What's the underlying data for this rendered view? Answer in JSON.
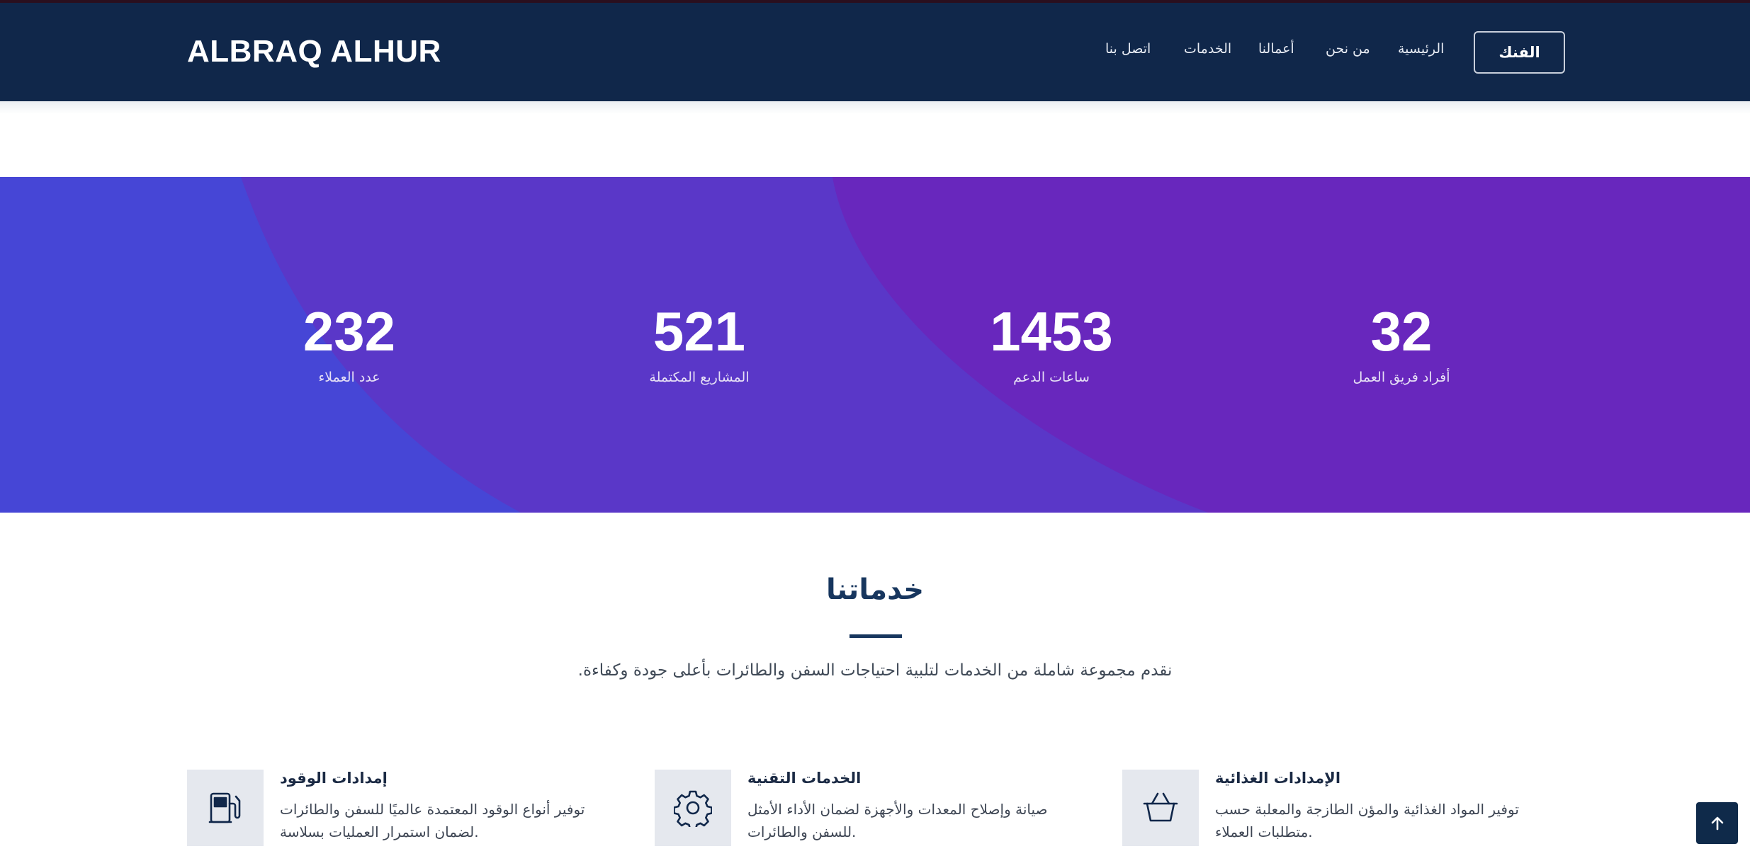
{
  "header": {
    "brand": "ALBRAQ ALHUR",
    "nav": [
      {
        "label": "الرئيسية"
      },
      {
        "label": "من نحن"
      },
      {
        "label": "أعمالنا"
      },
      {
        "label": "الخدمات"
      },
      {
        "label": "اتصل بنا"
      }
    ],
    "cta": "الفنك"
  },
  "stats": [
    {
      "value": "232",
      "label": "عدد العملاء"
    },
    {
      "value": "521",
      "label": "المشاريع المكتملة"
    },
    {
      "value": "1453",
      "label": "ساعات الدعم"
    },
    {
      "value": "32",
      "label": "أفراد فريق العمل"
    }
  ],
  "services_section": {
    "title": "خدماتنا",
    "subtitle": ".نقدم مجموعة شاملة من الخدمات لتلبية احتياجات السفن والطائرات بأعلى جودة وكفاءة"
  },
  "services": [
    {
      "icon": "fuel-pump-icon",
      "title": "إمدادات الوقود",
      "description": "توفير أنواع الوقود المعتمدة عالميًا للسفن والطائرات .لضمان استمرار العمليات بسلاسة"
    },
    {
      "icon": "gear-icon",
      "title": "الخدمات التقنية",
      "description": "صيانة وإصلاح المعدات والأجهزة لضمان الأداء الأمثل .للسفن والطائرات"
    },
    {
      "icon": "basket-icon",
      "title": "الإمدادات الغذائية",
      "description": "توفير المواد الغذائية والمؤن الطازجة والمعلبة حسب .متطلبات العملاء"
    }
  ],
  "colors": {
    "header_bg": "#10274a",
    "stats_bg_left": "#4646d6",
    "stats_bg_mid": "#5a37c8",
    "stats_bg_right": "#6827bd",
    "accent_dark": "#17365e"
  },
  "scroll_top": {
    "icon": "arrow-up-icon"
  }
}
